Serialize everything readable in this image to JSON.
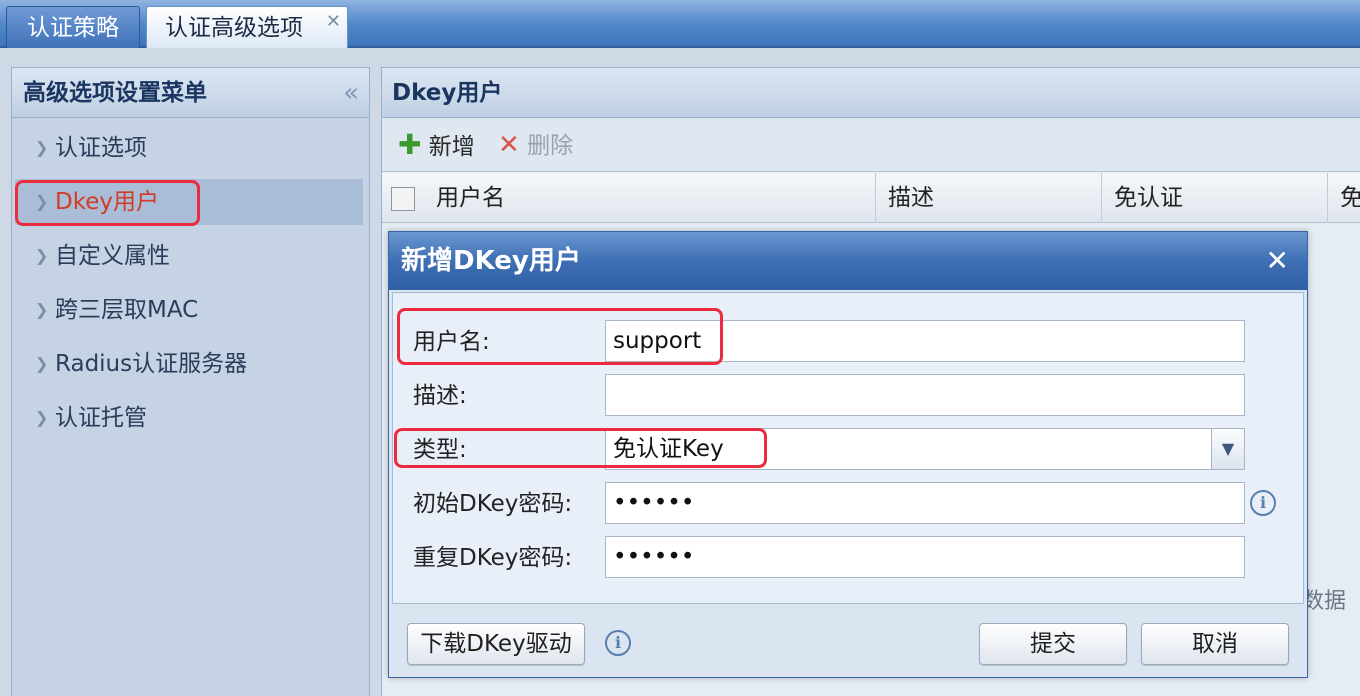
{
  "tabs": [
    {
      "label": "认证策略"
    },
    {
      "label": "认证高级选项",
      "close_icon": "close-icon"
    }
  ],
  "sidebar": {
    "title": "高级选项设置菜单",
    "collapse_glyph": "«",
    "items": [
      {
        "label": "认证选项"
      },
      {
        "label": "Dkey用户"
      },
      {
        "label": "自定义属性"
      },
      {
        "label": "跨三层取MAC"
      },
      {
        "label": "Radius认证服务器"
      },
      {
        "label": "认证托管"
      }
    ]
  },
  "main": {
    "title": "Dkey用户",
    "toolbar": {
      "add_label": "新增",
      "delete_label": "删除"
    },
    "grid_columns": [
      "用户名",
      "描述",
      "免认证",
      "免"
    ],
    "nodata_text": "数据"
  },
  "dialog": {
    "title": "新增DKey用户",
    "fields": {
      "username_label": "用户名:",
      "username_value": "support",
      "description_label": "描述:",
      "description_value": "",
      "type_label": "类型:",
      "type_value": "免认证Key",
      "init_pwd_label": "初始DKey密码:",
      "init_pwd_value": "••••••",
      "repeat_pwd_label": "重复DKey密码:",
      "repeat_pwd_value": "••••••"
    },
    "footer": {
      "download_label": "下载DKey驱动",
      "submit_label": "提交",
      "cancel_label": "取消"
    }
  },
  "colors": {
    "highlight_box": "#ec2c3e",
    "selected_item_text": "#d03b2a",
    "title_bar": "#3e6fb4"
  }
}
